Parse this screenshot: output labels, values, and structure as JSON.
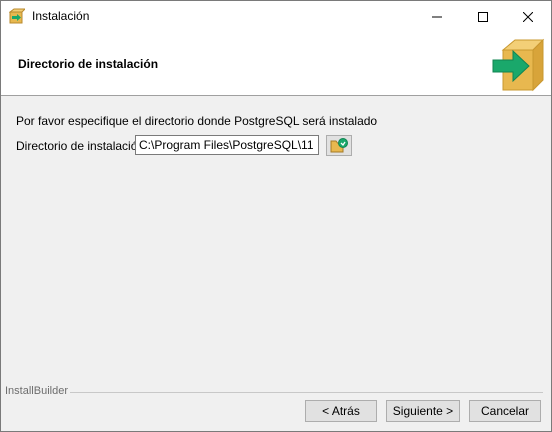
{
  "window": {
    "title": "Instalación"
  },
  "header": {
    "title": "Directorio de instalación",
    "graphic": "box-arrow-icon"
  },
  "main": {
    "instruction": "Por favor especifique el directorio donde PostgreSQL será instalado",
    "directory_label": "Directorio de instalación",
    "directory_value": "C:\\Program Files\\PostgreSQL\\11"
  },
  "footer": {
    "brand": "InstallBuilder",
    "back_label": "< Atrás",
    "next_label": "Siguiente >",
    "cancel_label": "Cancelar"
  },
  "colors": {
    "accent_green": "#1aa86b",
    "box_tan": "#e8b84f"
  }
}
